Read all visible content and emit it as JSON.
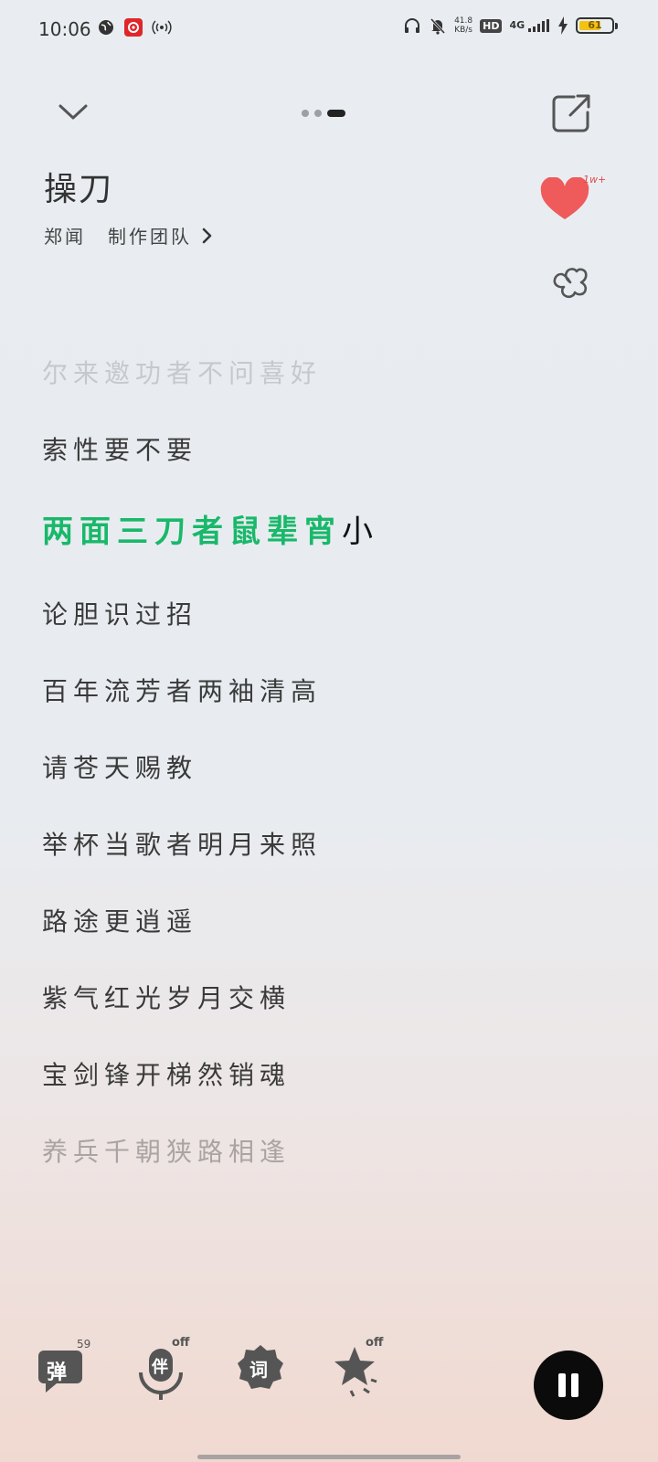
{
  "status_bar": {
    "time": "10:06",
    "net_speed_value": "41.8",
    "net_speed_unit": "KB/s",
    "hd_label": "HD",
    "network_label": "4G",
    "battery_level": "61"
  },
  "header": {
    "song_title": "操刀",
    "artist": "郑闻",
    "team": "制作团队",
    "page_index": 3,
    "page_count": 3
  },
  "like": {
    "count": "1w+"
  },
  "lyrics": {
    "lines": [
      "尔来邀功者不问喜好",
      "索性要不要",
      "两面三刀者鼠辈宵小",
      "论胆识过招",
      "百年流芳者两袖清高",
      "请苍天赐教",
      "举杯当歌者明月来照",
      "路途更逍遥",
      "紫气红光岁月交横",
      "宝剑锋开梯然销魂",
      "养兵千朝狭路相逢"
    ],
    "current_index": 2,
    "current_sung": "两面三刀者鼠辈宵",
    "current_unsung": "小"
  },
  "toolbar": {
    "danmaku_label": "弹",
    "danmaku_count": "59",
    "accompany_label": "伴",
    "accompany_state": "off",
    "lyrics_label": "词",
    "effects_state": "off"
  },
  "colors": {
    "accent_green": "#19b86a",
    "like_red": "#ef5a5a"
  }
}
